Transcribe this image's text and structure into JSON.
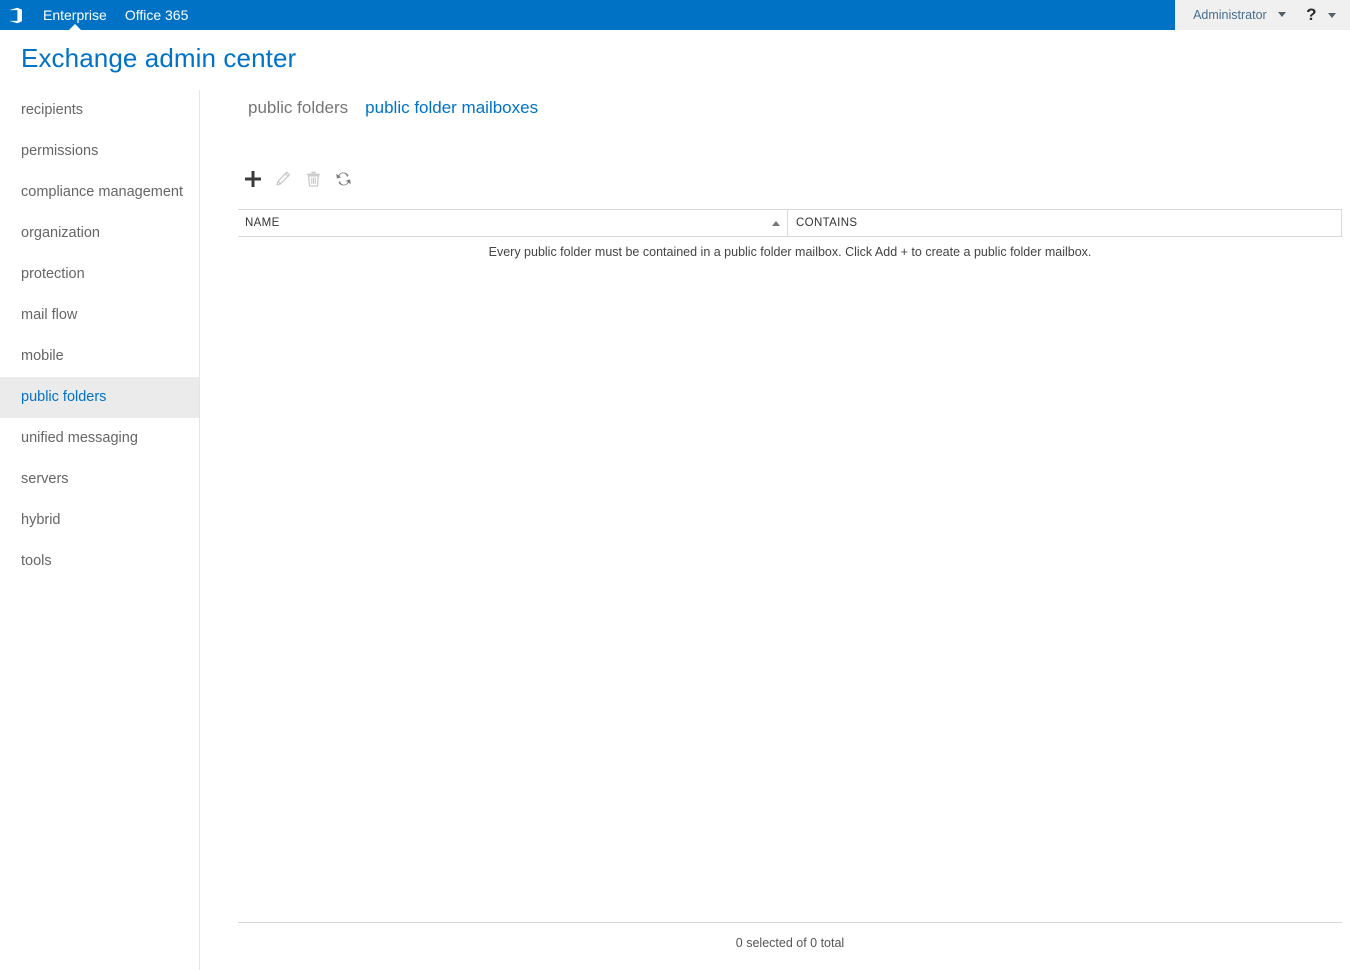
{
  "suite_bar": {
    "app_launcher_icon": "office-waffle-icon",
    "links": [
      {
        "label": "Enterprise",
        "active": true
      },
      {
        "label": "Office 365",
        "active": false
      }
    ],
    "account": {
      "name": "Administrator",
      "caret_icon": "chevron-down-icon"
    },
    "help": {
      "glyph": "?",
      "label": "Help",
      "caret_icon": "chevron-down-icon"
    },
    "background_color": "#0072c6",
    "right_background_color": "#f0f0f0"
  },
  "header": {
    "title": "Exchange admin center",
    "title_color": "#0072c6"
  },
  "sidebar": {
    "items": [
      {
        "label": "recipients",
        "selected": false
      },
      {
        "label": "permissions",
        "selected": false
      },
      {
        "label": "compliance management",
        "selected": false
      },
      {
        "label": "organization",
        "selected": false
      },
      {
        "label": "protection",
        "selected": false
      },
      {
        "label": "mail flow",
        "selected": false
      },
      {
        "label": "mobile",
        "selected": false
      },
      {
        "label": "public folders",
        "selected": true
      },
      {
        "label": "unified messaging",
        "selected": false
      },
      {
        "label": "servers",
        "selected": false
      },
      {
        "label": "hybrid",
        "selected": false
      },
      {
        "label": "tools",
        "selected": false
      }
    ],
    "selected_background": "#ebebeb",
    "selected_color": "#0072c6"
  },
  "main": {
    "tabs": [
      {
        "label": "public folders",
        "active": false
      },
      {
        "label": "public folder mailboxes",
        "active": true
      }
    ],
    "toolbar": [
      {
        "name": "add-button",
        "icon": "plus-icon",
        "label": "Add",
        "enabled": true
      },
      {
        "name": "edit-button",
        "icon": "pencil-icon",
        "label": "Edit",
        "enabled": false
      },
      {
        "name": "delete-button",
        "icon": "trash-icon",
        "label": "Delete",
        "enabled": false
      },
      {
        "name": "refresh-button",
        "icon": "refresh-icon",
        "label": "Refresh",
        "enabled": true
      }
    ],
    "grid": {
      "columns": [
        {
          "label": "NAME",
          "sorted": true,
          "sort_direction": "ascending"
        },
        {
          "label": "CONTAINS",
          "sorted": false,
          "sort_direction": ""
        }
      ],
      "rows": [],
      "empty_message": "Every public folder must be contained in a public folder mailbox. Click Add + to create a public folder mailbox."
    },
    "footer": {
      "status": "0 selected of 0 total"
    }
  }
}
